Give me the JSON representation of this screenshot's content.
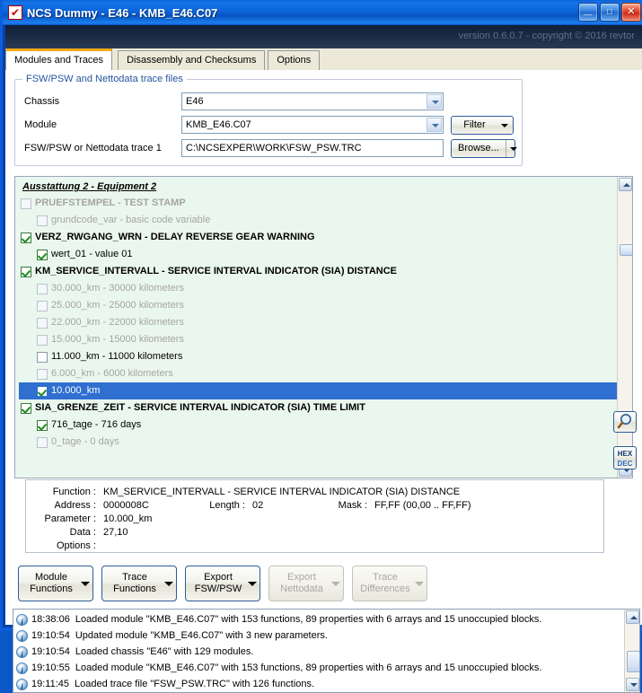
{
  "window": {
    "title": "NCS Dummy - E46 - KMB_E46.C07",
    "app_icon": "checkbox-icon",
    "minimize_label": "_",
    "maximize_label": "□",
    "close_label": "✕",
    "version_text": "version 0.6.0.7 - copyright © 2016 revtor"
  },
  "tabs": [
    {
      "label": "Modules and Traces",
      "active": true
    },
    {
      "label": "Disassembly and Checksums",
      "active": false
    },
    {
      "label": "Options",
      "active": false
    }
  ],
  "groupbox": {
    "title": "FSW/PSW and Nettodata trace files",
    "rows": [
      {
        "label": "Chassis",
        "value": "E46",
        "kind": "combo"
      },
      {
        "label": "Module",
        "value": "KMB_E46.C07",
        "kind": "combo",
        "button": "Filter"
      },
      {
        "label": "FSW/PSW or Nettodata trace 1",
        "value": "C:\\NCSEXPER\\WORK\\FSW_PSW.TRC",
        "kind": "text",
        "button": "Browse..."
      }
    ]
  },
  "tree": {
    "header": "Ausstattung 2 - Equipment 2",
    "rows": [
      {
        "indent": 0,
        "checked": false,
        "dim": true,
        "style": "boldgray",
        "text": "PRUEFSTEMPEL  -  TEST STAMP"
      },
      {
        "indent": 1,
        "checked": false,
        "dim": true,
        "style": "gray",
        "text": "grundcode_var  -  basic code variable"
      },
      {
        "indent": 0,
        "checked": true,
        "dim": false,
        "style": "bold",
        "text": "VERZ_RWGANG_WRN  -  DELAY REVERSE GEAR WARNING"
      },
      {
        "indent": 1,
        "checked": true,
        "dim": false,
        "style": "norm",
        "text": "wert_01  -  value 01"
      },
      {
        "indent": 0,
        "checked": true,
        "dim": false,
        "style": "bold",
        "text": "KM_SERVICE_INTERVALL  -  SERVICE INTERVAL INDICATOR (SIA) DISTANCE"
      },
      {
        "indent": 1,
        "checked": false,
        "dim": true,
        "style": "gray",
        "text": "30.000_km  -  30000 kilometers"
      },
      {
        "indent": 1,
        "checked": false,
        "dim": true,
        "style": "gray",
        "text": "25.000_km  -  25000 kilometers"
      },
      {
        "indent": 1,
        "checked": false,
        "dim": true,
        "style": "gray",
        "text": "22.000_km  -  22000 kilometers"
      },
      {
        "indent": 1,
        "checked": false,
        "dim": true,
        "style": "gray",
        "text": "15.000_km  -  15000 kilometers"
      },
      {
        "indent": 1,
        "checked": false,
        "dim": false,
        "style": "norm",
        "text": "11.000_km  -  11000 kilometers"
      },
      {
        "indent": 1,
        "checked": false,
        "dim": true,
        "style": "gray",
        "text": "6.000_km  -  6000 kilometers"
      },
      {
        "indent": 1,
        "checked": true,
        "dim": false,
        "style": "norm",
        "text": "10.000_km",
        "selected": true
      },
      {
        "indent": 0,
        "checked": true,
        "dim": false,
        "style": "bold",
        "text": "SIA_GRENZE_ZEIT  -  SERVICE INTERVAL INDICATOR (SIA) TIME LIMIT"
      },
      {
        "indent": 1,
        "checked": true,
        "dim": false,
        "style": "norm",
        "text": "716_tage  -  716 days"
      },
      {
        "indent": 1,
        "checked": false,
        "dim": true,
        "style": "gray",
        "text": "0_tage  -  0 days"
      }
    ]
  },
  "detail": {
    "function_key": "Function :",
    "function_value": "KM_SERVICE_INTERVALL  -  SERVICE INTERVAL INDICATOR (SIA) DISTANCE",
    "address_key": "Address :",
    "address_value": "0000008C",
    "length_key": "Length :",
    "length_value": "02",
    "mask_key": "Mask :",
    "mask_value": "FF,FF  (00,00 .. FF,FF)",
    "parameter_key": "Parameter :",
    "parameter_value": "10.000_km",
    "data_key": "Data :",
    "data_value": "27,10",
    "options_key": "Options :",
    "options_value": "",
    "search_icon": "magnifier-icon",
    "hexdec_top": "HEX",
    "hexdec_bottom": "DEC"
  },
  "actions": [
    {
      "label_line1": "Module",
      "label_line2": "Functions",
      "disabled": false
    },
    {
      "label_line1": "Trace",
      "label_line2": "Functions",
      "disabled": false
    },
    {
      "label_line1": "Export",
      "label_line2": "FSW/PSW",
      "disabled": false
    },
    {
      "label_line1": "Export",
      "label_line2": "Nettodata",
      "disabled": true
    },
    {
      "label_line1": "Trace",
      "label_line2": "Differences",
      "disabled": true
    }
  ],
  "log": [
    {
      "time": "18:38:06",
      "message": "Loaded module \"KMB_E46.C07\" with 153 functions, 89 properties with 6 arrays and 15 unoccupied blocks."
    },
    {
      "time": "19:10:54",
      "message": "Updated module \"KMB_E46.C07\" with 3 new parameters."
    },
    {
      "time": "19:10:54",
      "message": "Loaded chassis \"E46\" with 129 modules."
    },
    {
      "time": "19:10:55",
      "message": "Loaded module \"KMB_E46.C07\" with 153 functions, 89 properties with 6 arrays and 15 unoccupied blocks."
    },
    {
      "time": "19:11:45",
      "message": "Loaded trace file \"FSW_PSW.TRC\" with 126 functions."
    }
  ],
  "colors": {
    "title_blue": "#0b62d8",
    "tab_accent": "#f0a918",
    "tree_bg": "#eaf7ee",
    "selection_blue": "#2f6fd0",
    "group_title": "#2456a0"
  }
}
